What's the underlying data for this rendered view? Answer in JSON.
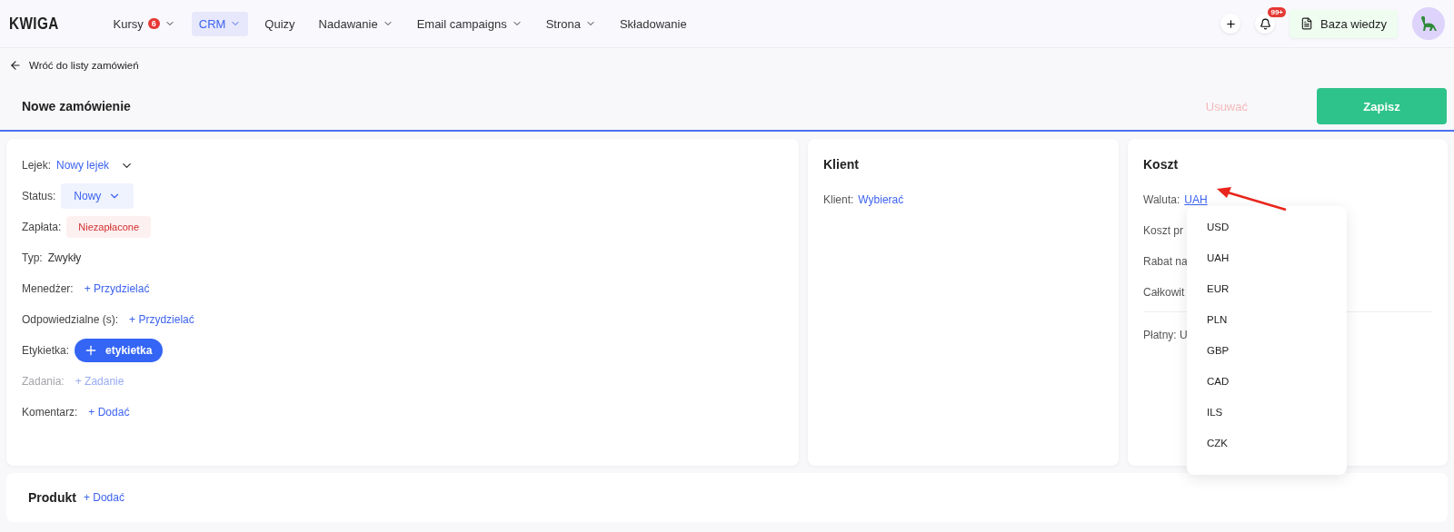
{
  "nav": {
    "logo": "KWIGA",
    "items": [
      {
        "label": "Kursy",
        "badge": "6",
        "caret": true,
        "selected": false
      },
      {
        "label": "CRM",
        "caret": true,
        "selected": true
      },
      {
        "label": "Quizy",
        "caret": false,
        "selected": false
      },
      {
        "label": "Nadawanie",
        "caret": true,
        "selected": false
      },
      {
        "label": "Email campaigns",
        "caret": true,
        "selected": false
      },
      {
        "label": "Strona",
        "caret": true,
        "selected": false
      },
      {
        "label": "Składowanie",
        "caret": false,
        "selected": false
      }
    ],
    "notifications_badge": "99+",
    "knowledge_button": "Baza wiedzy"
  },
  "back_link": "Wróć do listy zamówień",
  "header": {
    "title": "Nowe zamówienie",
    "delete_button": {
      "label": "Usuwać",
      "disabled": true
    },
    "save_button": "Zapisz"
  },
  "details": [
    {
      "kind": "dropdown-link",
      "label": "Lejek:",
      "value": "Nowy lejek"
    },
    {
      "kind": "pill",
      "label": "Status:",
      "value": "Nowy"
    },
    {
      "kind": "badge",
      "label": "Zapłata:",
      "value": "Niezapłacone"
    },
    {
      "kind": "text",
      "label": "Typ:",
      "value": "Zwykły"
    },
    {
      "kind": "link",
      "label": "Menedżer:",
      "value": "+ Przydzielać",
      "disabled": false
    },
    {
      "kind": "link",
      "label": "Odpowiedzialne (s):",
      "value": "+ Przydzielać",
      "disabled": false
    },
    {
      "kind": "button",
      "label": "Etykietka:",
      "value": "etykietka"
    },
    {
      "kind": "link",
      "label": "Zadania:",
      "value": "+ Zadanie",
      "disabled": true
    },
    {
      "kind": "link",
      "label": "Komentarz:",
      "value": "+ Dodać",
      "disabled": false
    }
  ],
  "client": {
    "title": "Klient",
    "label": "Klient:",
    "link": "Wybierać"
  },
  "cost": {
    "title": "Koszt",
    "currency_label": "Waluta:",
    "currency": "UAH",
    "rows": [
      "Koszt pr",
      "Rabat na",
      "Całkowit"
    ],
    "paid": "Płatny: U",
    "currency_menu": [
      "USD",
      "UAH",
      "EUR",
      "PLN",
      "GBP",
      "CAD",
      "ILS",
      "CZK"
    ]
  },
  "product": {
    "title": "Produkt",
    "link": "+ Dodać"
  }
}
